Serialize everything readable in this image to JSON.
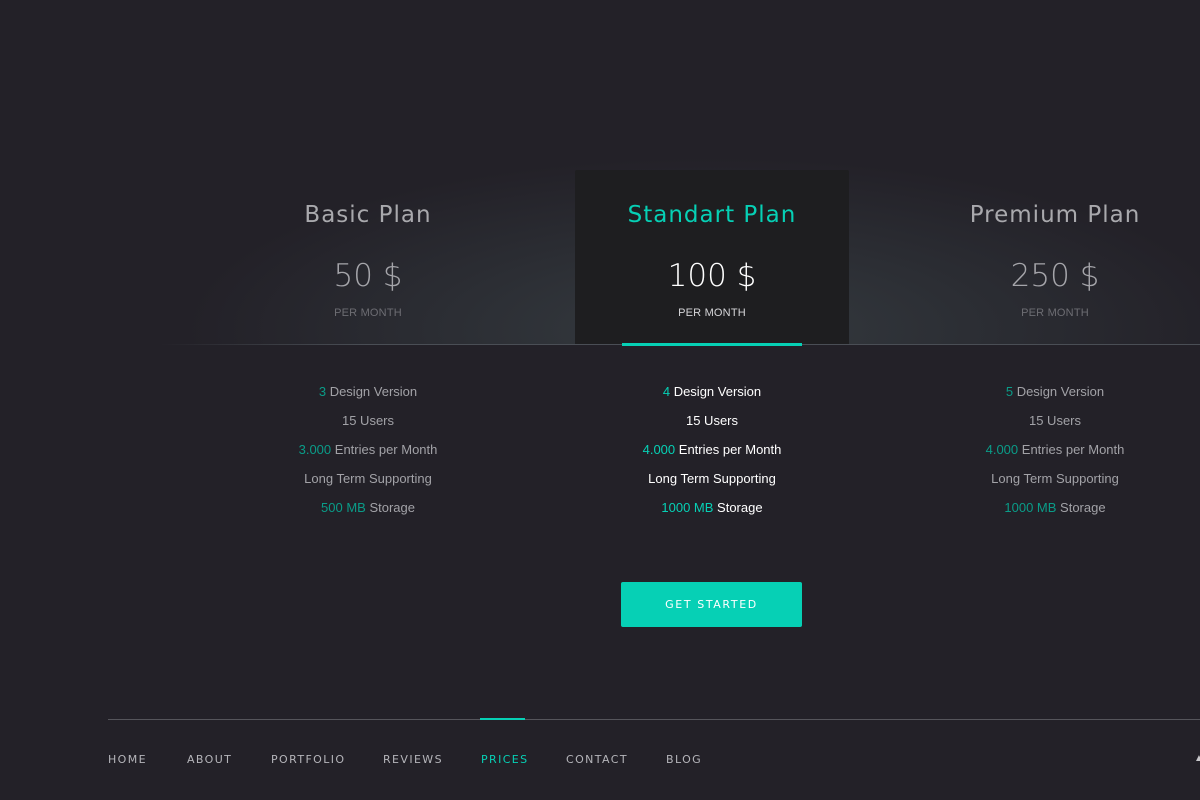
{
  "plans": [
    {
      "title": "Basic Plan",
      "price": "50 $",
      "period": "PER MONTH",
      "features": [
        {
          "hl": "3",
          "text": " Design Version"
        },
        {
          "hl": "",
          "text": "15 Users"
        },
        {
          "hl": "3.000",
          "text": " Entries per Month"
        },
        {
          "hl": "",
          "text": "Long Term Supporting"
        },
        {
          "hl": "500 MB",
          "text": " Storage"
        }
      ]
    },
    {
      "title": "Standart Plan",
      "price": "100 $",
      "period": "PER MONTH",
      "features": [
        {
          "hl": "4",
          "text": " Design Version"
        },
        {
          "hl": "",
          "text": "15 Users"
        },
        {
          "hl": "4.000",
          "text": " Entries per Month"
        },
        {
          "hl": "",
          "text": "Long Term Supporting"
        },
        {
          "hl": "1000 MB",
          "text": " Storage"
        }
      ]
    },
    {
      "title": "Premium Plan",
      "price": "250 $",
      "period": "PER MONTH",
      "features": [
        {
          "hl": "5",
          "text": " Design Version"
        },
        {
          "hl": "",
          "text": "15 Users"
        },
        {
          "hl": "4.000",
          "text": " Entries per Month"
        },
        {
          "hl": "",
          "text": "Long Term Supporting"
        },
        {
          "hl": "1000 MB",
          "text": " Storage"
        }
      ]
    }
  ],
  "cta": {
    "label": "GET STARTED"
  },
  "nav": {
    "items": [
      "HOME",
      "ABOUT",
      "PORTFOLIO",
      "REVIEWS",
      "PRICES",
      "CONTACT",
      "BLOG"
    ],
    "active": "PRICES"
  },
  "colors": {
    "accent": "#06d0b5",
    "background": "#232128",
    "featured_card": "#1e1e20"
  },
  "icons": {
    "edge_icon": "partial-icon"
  }
}
